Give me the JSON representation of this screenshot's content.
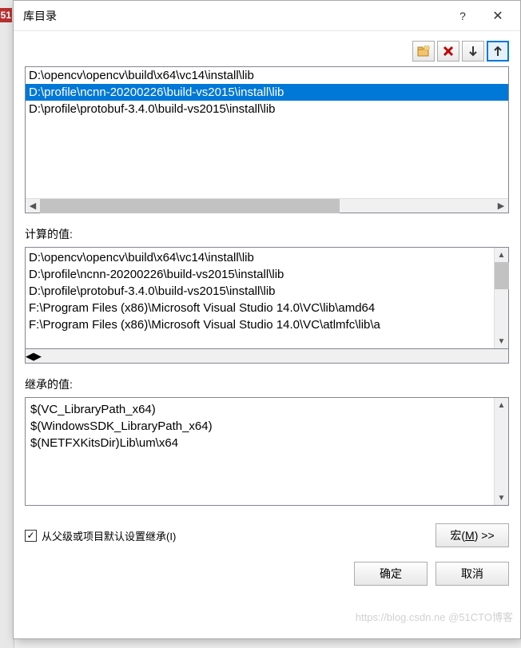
{
  "bg": {
    "badge": "51"
  },
  "title": "库目录",
  "entries": [
    "D:\\opencv\\opencv\\build\\x64\\vc14\\install\\lib",
    "D:\\profile\\ncnn-20200226\\build-vs2015\\install\\lib",
    "D:\\profile\\protobuf-3.4.0\\build-vs2015\\install\\lib"
  ],
  "selected_index": 1,
  "labels": {
    "calculated": "计算的值:",
    "inherited": "继承的值:",
    "inherit_checkbox": "从父级或项目默认设置继承(I)",
    "macros": "宏(M) >>",
    "ok": "确定",
    "cancel": "取消",
    "help": "?"
  },
  "calculated": [
    "D:\\opencv\\opencv\\build\\x64\\vc14\\install\\lib",
    "D:\\profile\\ncnn-20200226\\build-vs2015\\install\\lib",
    "D:\\profile\\protobuf-3.4.0\\build-vs2015\\install\\lib",
    "F:\\Program Files (x86)\\Microsoft Visual Studio 14.0\\VC\\lib\\amd64",
    "F:\\Program Files (x86)\\Microsoft Visual Studio 14.0\\VC\\atlmfc\\lib\\a"
  ],
  "inherited": [
    "$(VC_LibraryPath_x64)",
    "$(WindowsSDK_LibraryPath_x64)",
    "$(NETFXKitsDir)Lib\\um\\x64"
  ],
  "inherit_checked": true,
  "watermark": "https://blog.csdn.ne @51CTO博客"
}
